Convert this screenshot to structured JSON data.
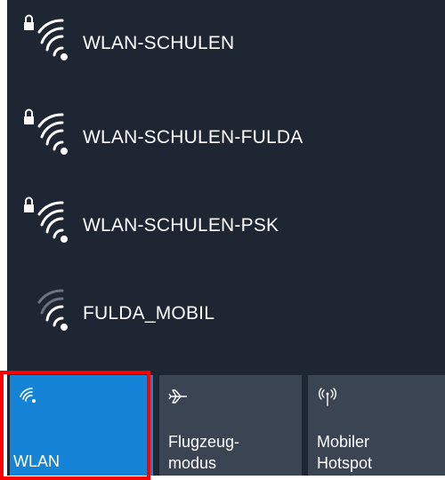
{
  "networks": [
    {
      "ssid": "WLAN-SCHULEN",
      "secured": true,
      "icon": "wifi-secured-icon"
    },
    {
      "ssid": "WLAN-SCHULEN-FULDA",
      "secured": true,
      "icon": "wifi-secured-icon"
    },
    {
      "ssid": "WLAN-SCHULEN-PSK",
      "secured": true,
      "icon": "wifi-secured-icon"
    },
    {
      "ssid": "FULDA_MOBIL",
      "secured": false,
      "icon": "wifi-weak-icon"
    }
  ],
  "quick_actions": {
    "wlan": {
      "label": "WLAN",
      "active": true,
      "icon": "wifi-icon"
    },
    "flight_mode": {
      "label_line1": "Flugzeug-",
      "label_line2": "modus",
      "active": false,
      "icon": "airplane-icon"
    },
    "mobile_hotspot": {
      "label_line1": "Mobiler",
      "label_line2": "Hotspot",
      "active": false,
      "icon": "hotspot-icon"
    }
  },
  "colors": {
    "panel_bg": "#1e2533",
    "tile_bg": "#3b4452",
    "accent": "#1583d6",
    "highlight": "#ff0000"
  }
}
